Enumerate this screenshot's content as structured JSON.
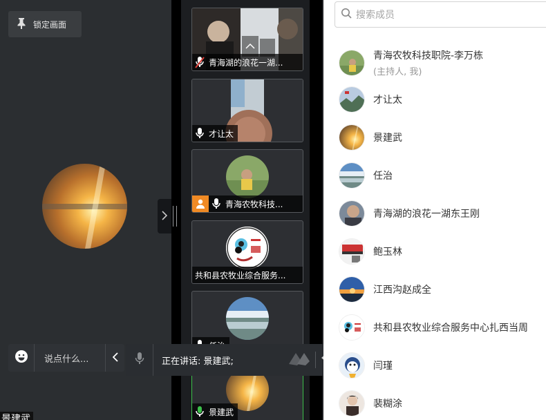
{
  "stage": {
    "lock_label": "锁定画面",
    "bottom_name": "景建武"
  },
  "chat": {
    "placeholder": "说点什么..."
  },
  "speaking": {
    "text": "正在讲话: 景建武;"
  },
  "tiles": [
    {
      "name": "青海湖的浪花一湖...",
      "mic": "muted"
    },
    {
      "name": "才让太",
      "mic": "on"
    },
    {
      "name": "青海农牧科技...",
      "mic": "on",
      "host": true
    },
    {
      "name": "共和县农牧业综合服务...",
      "mic": "none"
    },
    {
      "name": "任治",
      "mic": "on"
    },
    {
      "name": "景建武",
      "mic": "active"
    }
  ],
  "panel": {
    "search_placeholder": "搜索成员",
    "members": [
      {
        "name": "青海农牧科技职院-李万栋",
        "sub": "(主持人, 我)"
      },
      {
        "name": "才让太"
      },
      {
        "name": "景建武"
      },
      {
        "name": "任治"
      },
      {
        "name": "青海湖的浪花一湖东王刚"
      },
      {
        "name": "鲍玉林"
      },
      {
        "name": "江西沟赵成全"
      },
      {
        "name": "共和县农牧业综合服务中心扎西当周"
      },
      {
        "name": "闫瑾"
      },
      {
        "name": "裴糊涂"
      }
    ]
  },
  "colors": {
    "accent_active_mic": "#3cc04a",
    "host_badge": "#f08a24",
    "muted_mic": "#e0413a"
  }
}
